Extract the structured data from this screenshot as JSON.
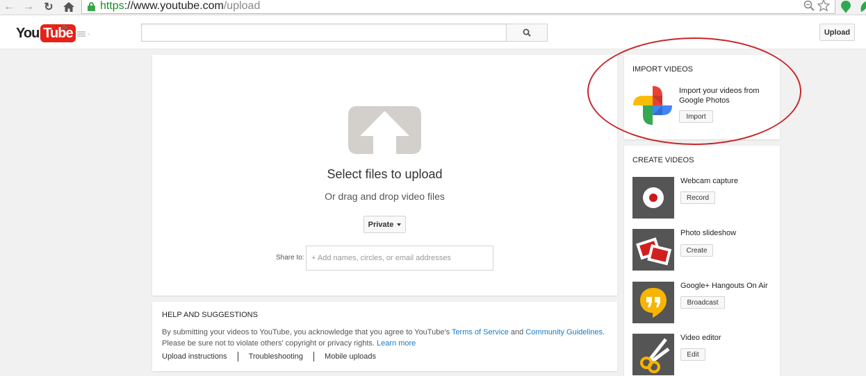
{
  "browser": {
    "url_scheme": "https",
    "url_host": "://www.youtube.com",
    "url_path": "/upload"
  },
  "masthead": {
    "logo_you": "You",
    "logo_tube": "Tube",
    "country": "IN",
    "guide_dash": "-",
    "upload_label": "Upload"
  },
  "upload": {
    "title": "Select files to upload",
    "subtitle": "Or drag and drop video files",
    "privacy_label": "Private",
    "share_label": "Share to:",
    "share_placeholder": "+ Add names, circles, or email addresses"
  },
  "help": {
    "title": "HELP AND SUGGESTIONS",
    "text_1": "By submitting your videos to YouTube, you acknowledge that you agree to YouTube's",
    "tos_link": "Terms of Service",
    "and": "and",
    "guidelines_link": "Community Guidelines",
    "period": ".",
    "text_2": "Please be sure not to violate others' copyright or privacy rights.",
    "learn_more": "Learn more",
    "links": [
      "Upload instructions",
      "Troubleshooting",
      "Mobile uploads"
    ]
  },
  "import": {
    "title": "IMPORT VIDEOS",
    "text": "Import your videos from Google Photos",
    "button": "Import"
  },
  "create": {
    "title": "CREATE VIDEOS",
    "tools": [
      {
        "name": "Webcam capture",
        "button": "Record"
      },
      {
        "name": "Photo slideshow",
        "button": "Create"
      },
      {
        "name": "Google+ Hangouts On Air",
        "button": "Broadcast"
      },
      {
        "name": "Video editor",
        "button": "Edit"
      }
    ]
  },
  "colors": {
    "accent_red": "#e62117",
    "link_blue": "#167ac6",
    "annotation_red": "#c8262b"
  }
}
